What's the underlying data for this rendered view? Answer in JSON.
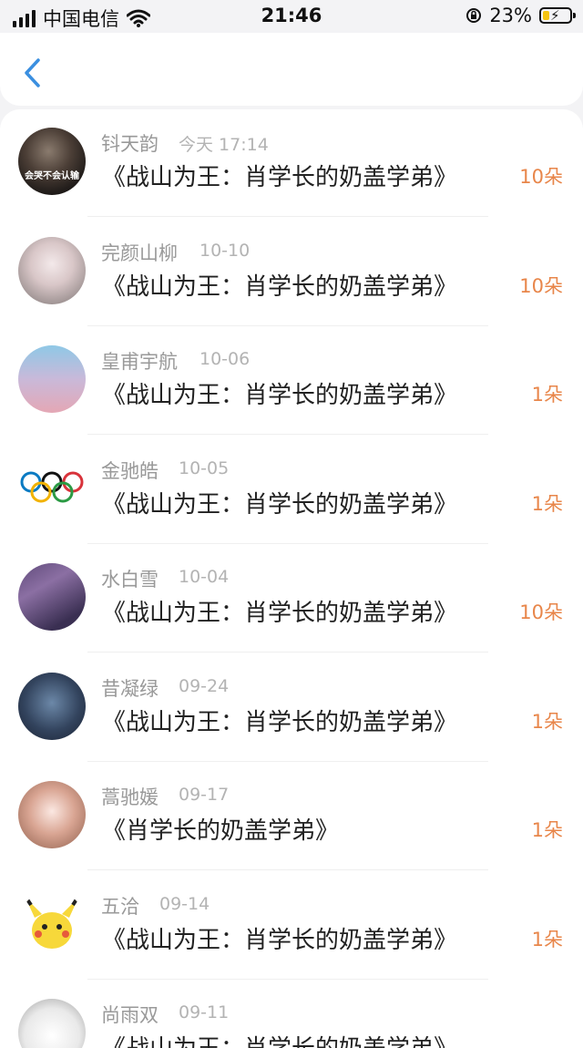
{
  "status_bar": {
    "carrier": "中国电信",
    "time": "21:46",
    "battery": "23%"
  },
  "header": {
    "back_icon": "chevron-left-icon"
  },
  "entries": [
    {
      "name": "钭天韵",
      "date": "今天 17:14",
      "title": "《战山为王：肖学长的奶盖学弟》",
      "count": "10朵",
      "avatar_caption": "会哭不会认输"
    },
    {
      "name": "完颜山柳",
      "date": "10-10",
      "title": "《战山为王：肖学长的奶盖学弟》",
      "count": "10朵",
      "avatar_caption": ""
    },
    {
      "name": "皇甫宇航",
      "date": "10-06",
      "title": "《战山为王：肖学长的奶盖学弟》",
      "count": "1朵",
      "avatar_caption": ""
    },
    {
      "name": "金驰皓",
      "date": "10-05",
      "title": "《战山为王：肖学长的奶盖学弟》",
      "count": "1朵",
      "avatar_caption": ""
    },
    {
      "name": "水白雪",
      "date": "10-04",
      "title": "《战山为王：肖学长的奶盖学弟》",
      "count": "10朵",
      "avatar_caption": ""
    },
    {
      "name": "昔凝绿",
      "date": "09-24",
      "title": "《战山为王：肖学长的奶盖学弟》",
      "count": "1朵",
      "avatar_caption": ""
    },
    {
      "name": "蒿驰媛",
      "date": "09-17",
      "title": "《肖学长的奶盖学弟》",
      "count": "1朵",
      "avatar_caption": ""
    },
    {
      "name": "五洽",
      "date": "09-14",
      "title": "《战山为王：肖学长的奶盖学弟》",
      "count": "1朵",
      "avatar_caption": ""
    },
    {
      "name": "尚雨双",
      "date": "09-11",
      "title": "《战山为王：肖学长的奶盖学弟》",
      "count": "",
      "avatar_caption": ""
    }
  ]
}
